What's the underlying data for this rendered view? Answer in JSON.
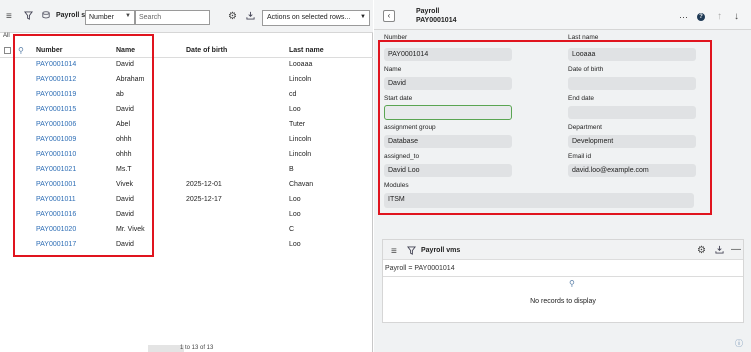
{
  "list": {
    "title": "Payroll s",
    "search_field": "Number",
    "search_placeholder": "Search",
    "actions_label": "Actions on selected rows...",
    "all_label": "All",
    "columns": [
      "Number",
      "Name",
      "Date of birth",
      "Last name"
    ],
    "rows": [
      {
        "number": "PAY0001014",
        "name": "David",
        "dob": "",
        "last": "Looaaa"
      },
      {
        "number": "PAY0001012",
        "name": "Abraham",
        "dob": "",
        "last": "Lincoln"
      },
      {
        "number": "PAY0001019",
        "name": "ab",
        "dob": "",
        "last": "cd"
      },
      {
        "number": "PAY0001015",
        "name": "David",
        "dob": "",
        "last": "Loo"
      },
      {
        "number": "PAY0001006",
        "name": "Abel",
        "dob": "",
        "last": "Tuter"
      },
      {
        "number": "PAY0001009",
        "name": "ohhh",
        "dob": "",
        "last": "Lincoln"
      },
      {
        "number": "PAY0001010",
        "name": "ohhh",
        "dob": "",
        "last": "Lincoln"
      },
      {
        "number": "PAY0001021",
        "name": "Ms.T",
        "dob": "",
        "last": "B"
      },
      {
        "number": "PAY0001001",
        "name": "Vivek",
        "dob": "2025-12-01",
        "last": "Chavan"
      },
      {
        "number": "PAY0001011",
        "name": "David",
        "dob": "2025-12-17",
        "last": "Loo"
      },
      {
        "number": "PAY0001016",
        "name": "David",
        "dob": "",
        "last": "Loo"
      },
      {
        "number": "PAY0001020",
        "name": "Mr. Vivek",
        "dob": "",
        "last": "C"
      },
      {
        "number": "PAY0001017",
        "name": "David",
        "dob": "",
        "last": "Loo"
      }
    ],
    "pager_text": "1  to 13 of 13"
  },
  "record": {
    "table": "Payroll",
    "number": "PAY0001014",
    "fields": {
      "number_label": "Number",
      "number_value": "PAY0001014",
      "last_name_label": "Last name",
      "last_name_value": "Looaaa",
      "name_label": "Name",
      "name_value": "David",
      "dob_label": "Date of birth",
      "dob_value": "",
      "start_label": "Start date",
      "start_value": "",
      "end_label": "End date",
      "end_value": "",
      "group_label": "assignment group",
      "group_value": "Database",
      "dept_label": "Department",
      "dept_value": "Development",
      "assigned_label": "assigned_to",
      "assigned_value": "David Loo",
      "email_label": "Email id",
      "email_value": "david.loo@example.com",
      "modules_label": "Modules",
      "modules_value": "ITSM"
    },
    "related": {
      "title": "Payroll vms",
      "filter": "Payroll = PAY0001014",
      "empty_message": "No records to display"
    }
  },
  "icons": [
    "menu-icon",
    "filter-icon",
    "list-icon",
    "gear-icon",
    "download-icon",
    "more-icon",
    "help-icon",
    "arrow-up-icon",
    "arrow-down-icon",
    "search-icon",
    "minus-icon",
    "back-icon"
  ],
  "colors": {
    "link": "#2d6db5",
    "highlight_box": "#e0141e",
    "focus_border": "#5aa552",
    "field_bg": "#e0e2e4"
  }
}
